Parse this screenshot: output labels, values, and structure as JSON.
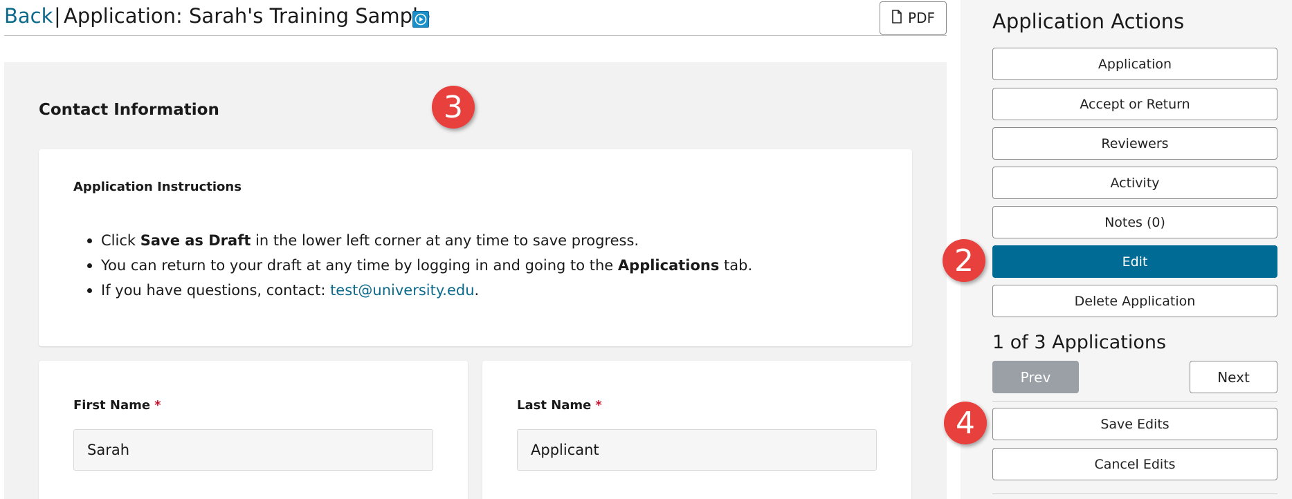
{
  "header": {
    "back_label": "Back",
    "separator": "|",
    "title": "Application: Sarah's Training Sample",
    "video_icon": "play-video-icon",
    "pdf_label": "PDF",
    "pdf_icon": "file-icon"
  },
  "main": {
    "section_title": "Contact Information",
    "instructions": {
      "heading": "Application Instructions",
      "items": [
        {
          "pre": "Click ",
          "bold": "Save as Draft",
          "post": " in the lower left corner at any time to save progress."
        },
        {
          "pre": "You can return to your draft at any time by logging in and going to the ",
          "bold": "Applications",
          "post": " tab."
        },
        {
          "pre": "If you have questions, contact: ",
          "link": "test@university.edu",
          "post": "."
        }
      ]
    },
    "first_name": {
      "label": "First Name",
      "required_mark": "*",
      "value": "Sarah"
    },
    "last_name": {
      "label": "Last Name",
      "required_mark": "*",
      "value": "Applicant"
    }
  },
  "sidebar": {
    "title": "Application Actions",
    "buttons": {
      "application": "Application",
      "accept_or_return": "Accept or Return",
      "reviewers": "Reviewers",
      "activity": "Activity",
      "notes": "Notes (0)",
      "edit": "Edit",
      "delete_application": "Delete Application"
    },
    "counter": "1 of 3 Applications",
    "prev_label": "Prev",
    "next_label": "Next",
    "save_edits": "Save Edits",
    "cancel_edits": "Cancel Edits"
  },
  "markers": [
    "2",
    "3",
    "4"
  ],
  "colors": {
    "accent": "#006b94",
    "link": "#0b6a8b",
    "marker": "#e8413d",
    "disabled": "#9aa0a6",
    "required": "#c8102e"
  }
}
